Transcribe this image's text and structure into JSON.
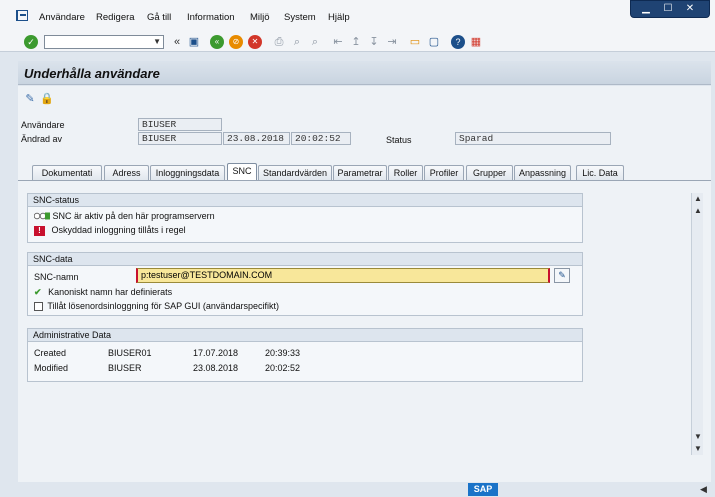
{
  "menu": {
    "items": [
      "Användare",
      "Redigera",
      "Gå till",
      "Information",
      "Miljö",
      "System",
      "Hjälp"
    ]
  },
  "toolbar": {
    "command_value": "",
    "icons": [
      "ok-icon",
      "save-icon",
      "back-icon",
      "exit-icon",
      "cancel-icon",
      "print-icon",
      "find-icon",
      "find-next-icon",
      "first-page-icon",
      "prev-page-icon",
      "next-page-icon",
      "last-page-icon",
      "new-session-icon",
      "shortcut-icon",
      "help-icon",
      "layout-icon"
    ]
  },
  "title": "Underhålla användare",
  "header": {
    "user_label": "Användare",
    "user_value": "BIUSER",
    "changed_by_label": "Ändrad av",
    "changed_by_value": "BIUSER",
    "changed_date": "23.08.2018",
    "changed_time": "20:02:52",
    "status_label": "Status",
    "status_value": "Sparad"
  },
  "tabs": [
    "Dokumentati",
    "Adress",
    "Inloggningsdata",
    "SNC",
    "Standardvärden",
    "Parametrar",
    "Roller",
    "Profiler",
    "Grupper",
    "Anpassning",
    "Lic. Data"
  ],
  "active_tab": "SNC",
  "snc_status": {
    "title": "SNC-status",
    "line1": "SNC är aktiv på den här programservern",
    "line2": "Oskyddad inloggning tillåts i regel"
  },
  "snc_data": {
    "title": "SNC-data",
    "name_label": "SNC-namn",
    "name_value": "p:testuser@TESTDOMAIN.COM",
    "canonical": "Kanoniskt namn har definierats",
    "allow_pw": "Tillåt lösenordsinloggning för SAP GUI (användarspecifikt)"
  },
  "admin": {
    "title": "Administrative Data",
    "rows": [
      {
        "label": "Created",
        "user": "BIUSER01",
        "date": "17.07.2018",
        "time": "20:39:33"
      },
      {
        "label": "Modified",
        "user": "BIUSER",
        "date": "23.08.2018",
        "time": "20:02:52"
      }
    ]
  },
  "colors": {
    "accent": "#1c4f8a",
    "required": "#f8e79a",
    "error": "#c8102e",
    "ok": "#3c9a2f"
  },
  "sap_logo": "SAP"
}
